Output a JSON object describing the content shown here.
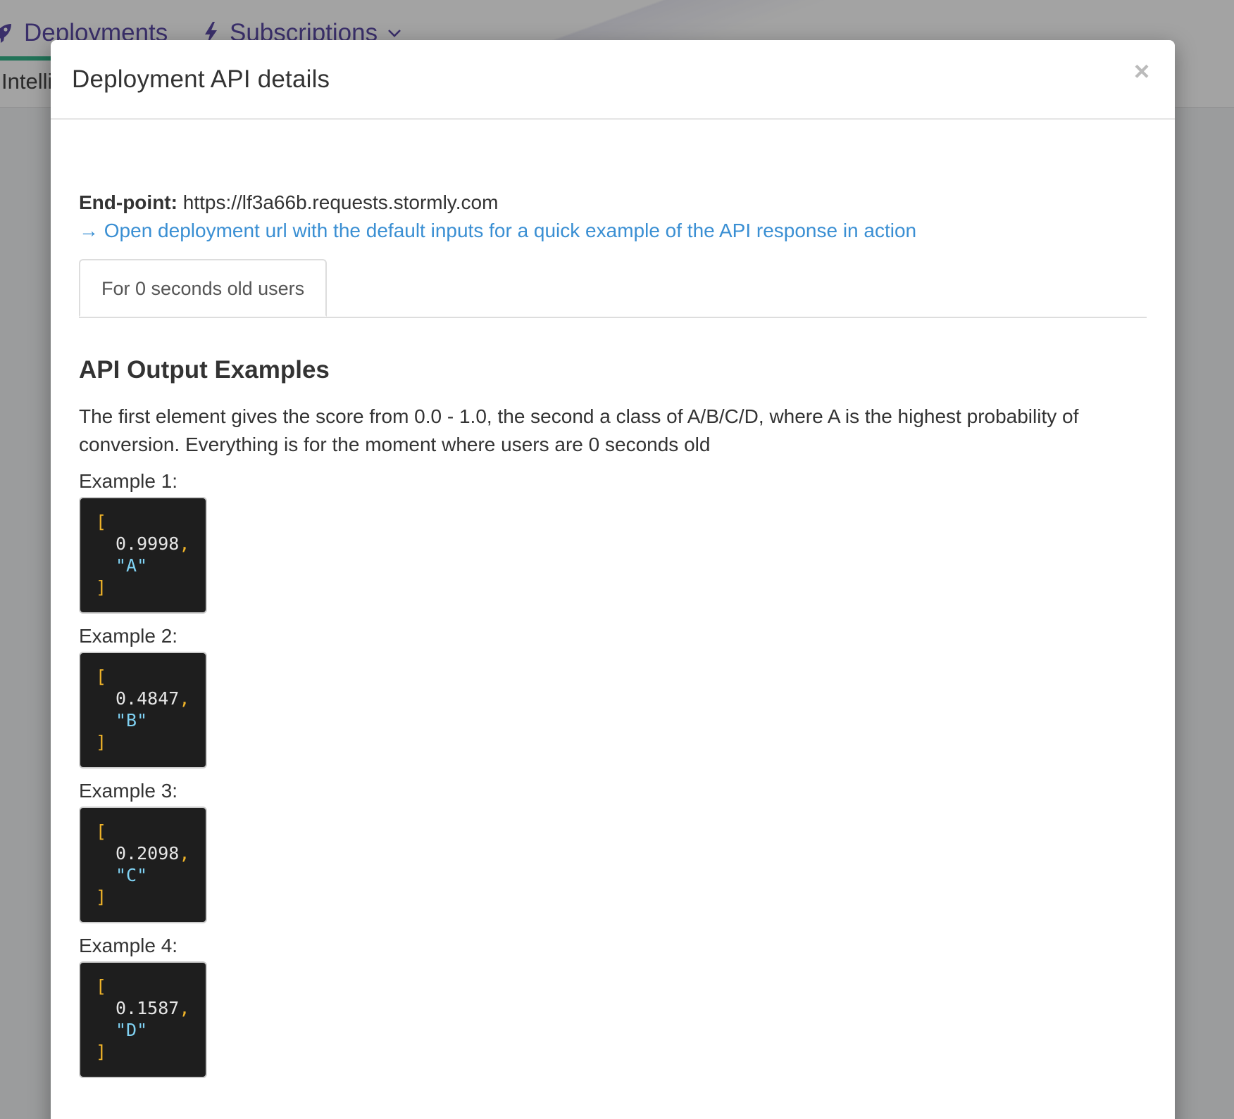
{
  "app": {
    "nav": {
      "deployments_label": "Deployments",
      "subscriptions_label": "Subscriptions"
    },
    "subbar_text": "Intelli",
    "colors": {
      "nav_text": "#5b4aa6",
      "active_underline": "#36b58a"
    }
  },
  "modal": {
    "title": "Deployment API details",
    "close_label": "×",
    "endpoint_label": "End-point:",
    "endpoint_url": "https://lf3a66b.requests.stormly.com",
    "quick_link": "→ Open deployment url with the default inputs for a quick example of the API response in action",
    "tabs": [
      {
        "label": "For 0 seconds old users"
      }
    ],
    "section_title": "API Output Examples",
    "description": "The first element gives the score from 0.0 - 1.0, the second a class of A/B/C/D, where A is the highest probability of conversion. Everything is for the moment where users are 0 seconds old",
    "examples": [
      {
        "label": "Example 1:",
        "open": "[",
        "score": "0.9998",
        "comma": ",",
        "class": "\"A\"",
        "close": "]"
      },
      {
        "label": "Example 2:",
        "open": "[",
        "score": "0.4847",
        "comma": ",",
        "class": "\"B\"",
        "close": "]"
      },
      {
        "label": "Example 3:",
        "open": "[",
        "score": "0.2098",
        "comma": ",",
        "class": "\"C\"",
        "close": "]"
      },
      {
        "label": "Example 4:",
        "open": "[",
        "score": "0.1587",
        "comma": ",",
        "class": "\"D\"",
        "close": "]"
      }
    ],
    "colors": {
      "link": "#3a8fd3",
      "code_bg": "#1e1e1e",
      "code_bracket": "#f0b429",
      "code_number": "#e6e6e6",
      "code_string": "#7fd1f2"
    }
  }
}
